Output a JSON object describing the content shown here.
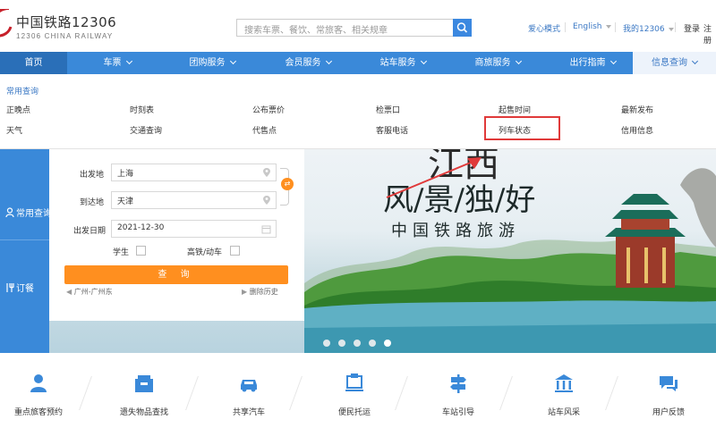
{
  "brand": {
    "name_cn": "中国铁路12306",
    "name_en": "12306 CHINA RAILWAY"
  },
  "search": {
    "placeholder": "搜索车票、餐饮、常旅客、相关规章"
  },
  "top_links": {
    "accessibility": "爱心模式",
    "language": "English",
    "my": "我的12306",
    "login": "登录",
    "register": "注册"
  },
  "nav": [
    {
      "label": "首页"
    },
    {
      "label": "车票"
    },
    {
      "label": "团购服务"
    },
    {
      "label": "会员服务"
    },
    {
      "label": "站车服务"
    },
    {
      "label": "商旅服务"
    },
    {
      "label": "出行指南"
    },
    {
      "label": "信息查询"
    }
  ],
  "dropdown": {
    "title": "常用查询",
    "row1": [
      "正晚点",
      "时刻表",
      "公布票价",
      "检票口",
      "起售时间",
      "最新发布"
    ],
    "row2": [
      "天气",
      "交通查询",
      "代售点",
      "客服电话",
      "列车状态",
      "信用信息"
    ]
  },
  "side_tabs": {
    "common_query": "常用查询",
    "order": "订餐"
  },
  "form": {
    "from_label": "出发地",
    "from_value": "上海",
    "to_label": "到达地",
    "to_value": "天津",
    "date_label": "出发日期",
    "date_value": "2021-12-30",
    "student_label": "学生",
    "hs_label": "高铁/动车",
    "query_label": "查 询",
    "history_route": "广州-广州东",
    "clear_history": "删除历史",
    "swap_icon": "⇄"
  },
  "banner": {
    "line1": "江西",
    "line2": "风/景/独/好",
    "line3": "中国铁路旅游"
  },
  "bottom_items": [
    {
      "label": "重点旅客预约",
      "icon": "person-icon"
    },
    {
      "label": "遗失物品查找",
      "icon": "box-icon"
    },
    {
      "label": "共享汽车",
      "icon": "car-icon"
    },
    {
      "label": "便民托运",
      "icon": "cart-icon"
    },
    {
      "label": "车站引导",
      "icon": "signpost-icon"
    },
    {
      "label": "站车风采",
      "icon": "station-icon"
    },
    {
      "label": "用户反馈",
      "icon": "chat-icon"
    }
  ],
  "colors": {
    "primary": "#3a89d9",
    "accent": "#ff8f1f",
    "highlight": "#e03a3a"
  }
}
